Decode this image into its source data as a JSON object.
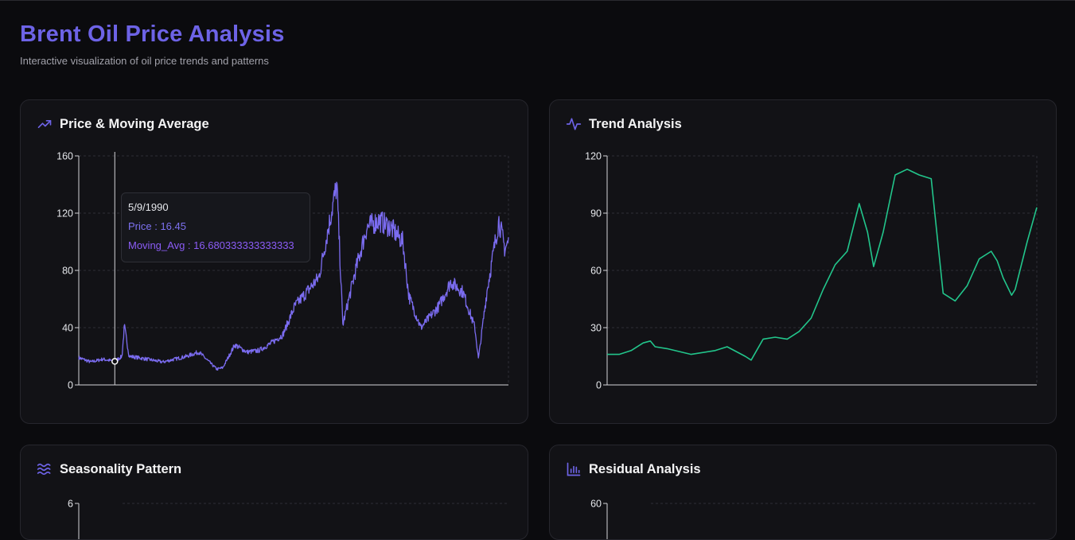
{
  "header": {
    "title": "Brent Oil Price Analysis",
    "subtitle": "Interactive visualization of oil price trends and patterns"
  },
  "colors": {
    "accent": "#6d63e6",
    "price": "#7b6cf0",
    "trend": "#22c58b"
  },
  "cards": [
    {
      "title": "Price & Moving Average",
      "icon": "trending-up-icon"
    },
    {
      "title": "Trend Analysis",
      "icon": "activity-icon"
    },
    {
      "title": "Seasonality Pattern",
      "icon": "waves-icon"
    },
    {
      "title": "Residual Analysis",
      "icon": "bar-chart-icon"
    }
  ],
  "tooltip": {
    "date": "5/9/1990",
    "price": "Price : 16.45",
    "moving_avg": "Moving_Avg : 16.680333333333333"
  },
  "chart_data": [
    {
      "type": "line",
      "name": "Price & Moving Average",
      "ylim": [
        0,
        160
      ],
      "yticks": [
        "0",
        "40",
        "80",
        "120",
        "160"
      ],
      "x": [
        1987,
        1988,
        1989,
        1990,
        1990.6,
        1990.8,
        1991.2,
        1992,
        1994,
        1996,
        1997,
        1998.5,
        1999,
        2000,
        2001,
        2002,
        2003,
        2004,
        2005,
        2006,
        2007,
        2008.5,
        2009,
        2010,
        2011,
        2012,
        2013,
        2014,
        2014.5,
        2015.5,
        2016,
        2017,
        2018,
        2019,
        2020,
        2020.3,
        2021,
        2022,
        2022.5,
        2022.8
      ],
      "series": [
        {
          "name": "Price",
          "values": [
            19,
            16,
            18,
            16.45,
            20,
            41,
            20,
            19,
            16,
            20,
            23,
            11,
            12,
            28,
            23,
            24,
            29,
            35,
            55,
            65,
            75,
            140,
            42,
            78,
            110,
            115,
            110,
            100,
            62,
            40,
            45,
            55,
            72,
            65,
            40,
            18,
            65,
            115,
            95,
            100
          ]
        }
      ]
    },
    {
      "type": "line",
      "name": "Trend Analysis",
      "ylim": [
        0,
        120
      ],
      "yticks": [
        "0",
        "30",
        "60",
        "90",
        "120"
      ],
      "x": [
        1987,
        1988,
        1989,
        1990,
        1990.6,
        1991,
        1992,
        1994,
        1996,
        1997,
        1998.5,
        1999,
        2000,
        2001,
        2002,
        2003,
        2004,
        2005,
        2006,
        2007,
        2008,
        2008.7,
        2009.2,
        2010,
        2011,
        2012,
        2013,
        2014,
        2015,
        2016,
        2017,
        2018,
        2019,
        2019.5,
        2020,
        2020.7,
        2021,
        2022,
        2022.8
      ],
      "series": [
        {
          "name": "Trend",
          "values": [
            16,
            16,
            18,
            22,
            23,
            20,
            19,
            16,
            18,
            20,
            15,
            13,
            24,
            25,
            24,
            28,
            35,
            50,
            63,
            70,
            95,
            80,
            62,
            80,
            110,
            113,
            110,
            108,
            48,
            44,
            52,
            66,
            70,
            65,
            56,
            47,
            50,
            75,
            93
          ]
        }
      ]
    },
    {
      "type": "line",
      "name": "Seasonality Pattern",
      "yticks": [
        "6"
      ]
    },
    {
      "type": "bar",
      "name": "Residual Analysis",
      "yticks": [
        "60"
      ]
    }
  ]
}
